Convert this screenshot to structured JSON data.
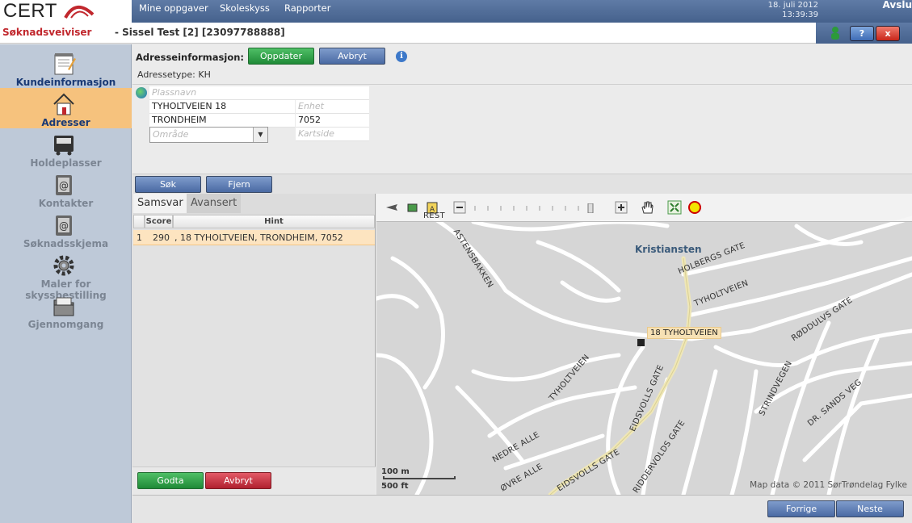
{
  "brand": {
    "logo_text": "CERT",
    "app_name": "Søknadsveiviser"
  },
  "nav": {
    "items": [
      "Mine oppgaver",
      "Skoleskyss",
      "Rapporter"
    ],
    "date": "18. juli 2012",
    "time": "13:39:39",
    "logout": "Avslu"
  },
  "title": {
    "client": "- Sissel Test [2] [23097788888]",
    "help_label": "?",
    "close_label": "x"
  },
  "sidebar": {
    "items": [
      {
        "label": "Kundeinformasjon",
        "icon": "notepad-icon"
      },
      {
        "label": "Adresser",
        "icon": "house-icon",
        "active": true
      },
      {
        "label": "Holdeplasser",
        "icon": "bus-stop-icon"
      },
      {
        "label": "Kontakter",
        "icon": "contacts-icon"
      },
      {
        "label": "Søknadsskjema",
        "icon": "form-icon"
      },
      {
        "label": "Maler for skyssbestilling",
        "icon": "gear-icon"
      },
      {
        "label": "Gjennomgang",
        "icon": "folder-icon"
      }
    ]
  },
  "address": {
    "header_label": "Adresseinformasjon:",
    "update_label": "Oppdater",
    "cancel_label": "Avbryt",
    "type_label": "Adressetype: KH",
    "placename_placeholder": "Plassnavn",
    "street": "TYHOLTVEIEN 18",
    "unit_placeholder": "Enhet",
    "city": "TRONDHEIM",
    "postcode": "7052",
    "area_placeholder": "Område",
    "mappage_placeholder": "Kartside",
    "search_label": "Søk",
    "remove_label": "Fjern"
  },
  "results": {
    "tabs": [
      "Samsvar",
      "Avansert"
    ],
    "columns": [
      "Score",
      "Hint"
    ],
    "rows": [
      {
        "index": "1",
        "score": "290",
        "hint": ", 18 TYHOLTVEIEN, TRONDHEIM, 7052"
      }
    ],
    "accept_label": "Godta",
    "cancel_label": "Avbryt"
  },
  "map": {
    "district": "Kristiansten",
    "callout": "18 TYHOLTVEIEN",
    "streets": [
      "ASTENSBAKKEN",
      "HOLBERGS GATE",
      "TYHOLTVEIEN",
      "RØDDULVS GATE",
      "TYHOLTVEIEN",
      "EIDSVOLLS GATE",
      "STRINDVEGEN",
      "DR. SANDS VEG",
      "NEDRE ALLE",
      "ØVRE ALLE",
      "EIDSVOLLS GATE",
      "RIDDERVOLDS GATE",
      "REST"
    ],
    "scale_m": "100 m",
    "scale_ft": "500 ft",
    "copyright": "Map data © 2011 SørTrøndelag Fylke"
  },
  "footer": {
    "prev_label": "Forrige",
    "next_label": "Neste"
  }
}
